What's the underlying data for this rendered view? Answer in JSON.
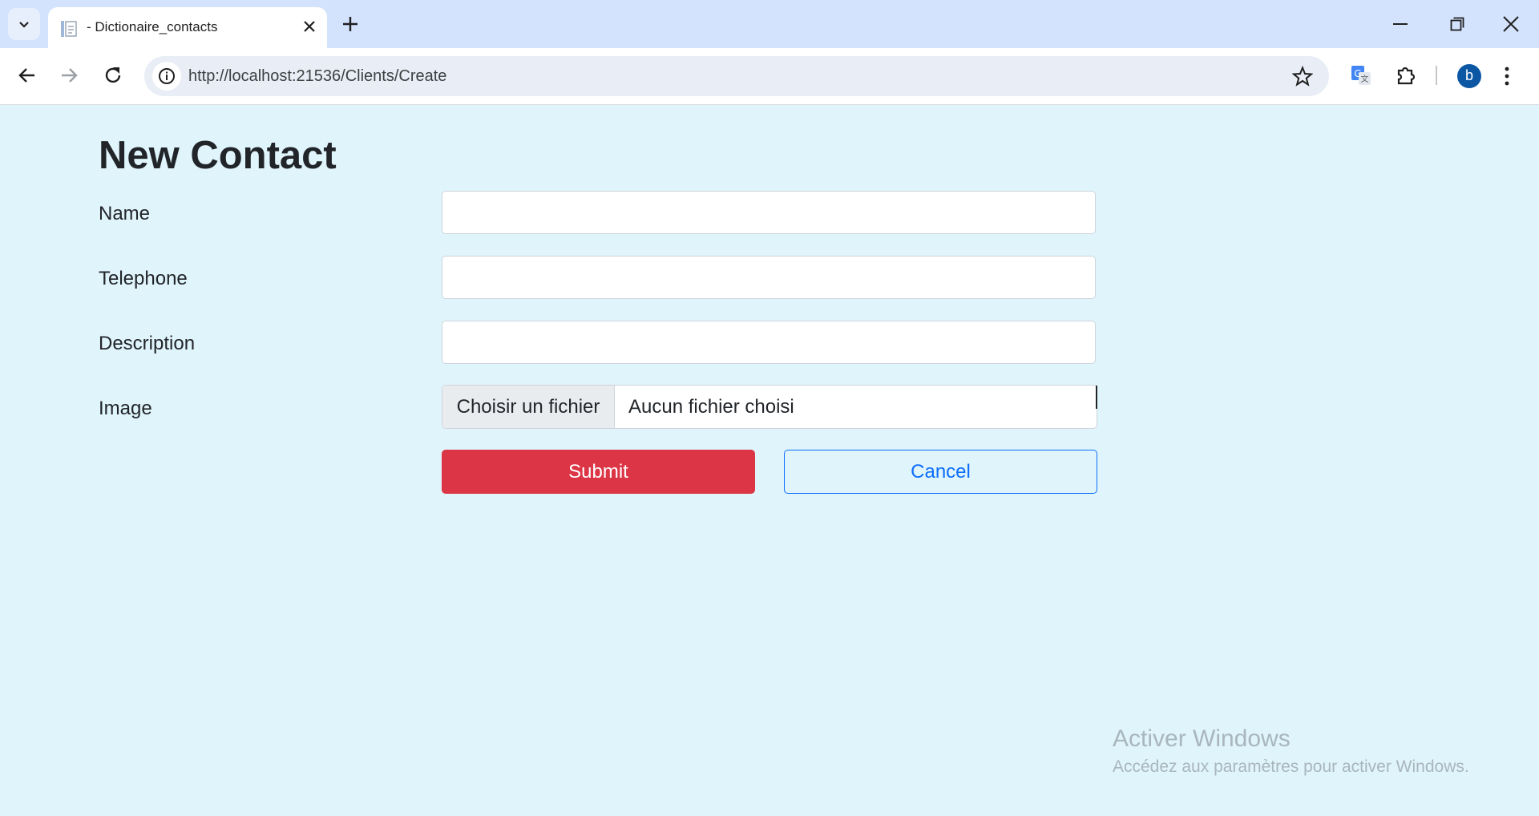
{
  "browser": {
    "tab_title": "- Dictionaire_contacts",
    "url": "http://localhost:21536/Clients/Create",
    "profile_initial": "b"
  },
  "page": {
    "title": "New Contact",
    "fields": {
      "name": {
        "label": "Name",
        "value": ""
      },
      "telephone": {
        "label": "Telephone",
        "value": ""
      },
      "description": {
        "label": "Description",
        "value": ""
      },
      "image": {
        "label": "Image",
        "button_label": "Choisir un fichier",
        "status": "Aucun fichier choisi"
      }
    },
    "actions": {
      "submit_label": "Submit",
      "cancel_label": "Cancel"
    }
  },
  "watermark": {
    "title": "Activer Windows",
    "subtitle": "Accédez aux paramètres pour activer Windows."
  },
  "colors": {
    "page_background": "#e0f4fb",
    "submit": "#dc3545",
    "cancel": "#0d6efd"
  },
  "icons": [
    "tab-search-icon",
    "page-favicon-icon",
    "close-icon",
    "plus-icon",
    "minimize-icon",
    "restore-icon",
    "window-close-icon",
    "back-arrow-icon",
    "forward-arrow-icon",
    "reload-icon",
    "site-info-icon",
    "star-icon",
    "translate-icon",
    "puzzle-icon",
    "kebab-menu-icon"
  ]
}
